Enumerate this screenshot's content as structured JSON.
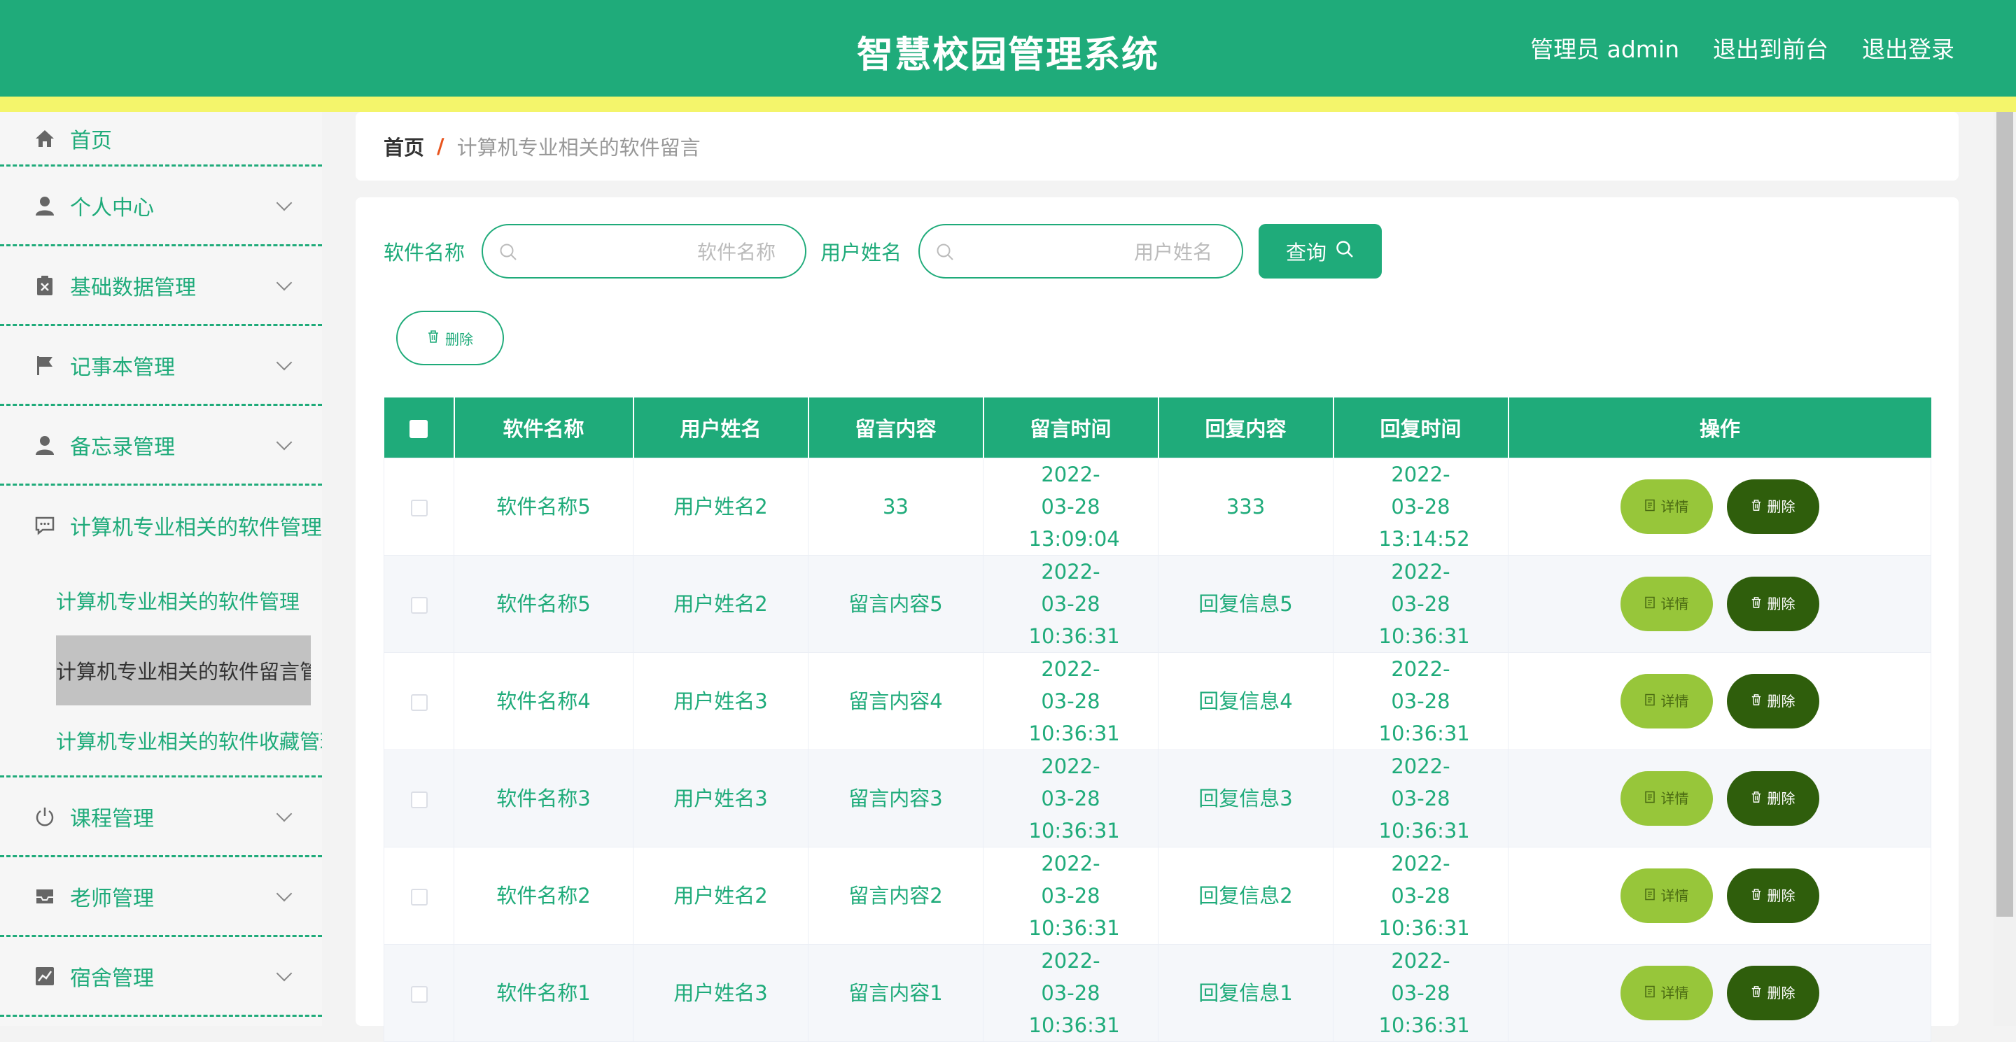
{
  "header": {
    "title": "智慧校园管理系统",
    "user_label": "管理员 admin",
    "to_front": "退出到前台",
    "logout": "退出登录"
  },
  "sidebar": {
    "home": "首页",
    "items": [
      {
        "label": "个人中心",
        "icon": "person-icon"
      },
      {
        "label": "基础数据管理",
        "icon": "clipboard-icon"
      },
      {
        "label": "记事本管理",
        "icon": "flag-icon"
      },
      {
        "label": "备忘录管理",
        "icon": "person-icon"
      }
    ],
    "software_group": {
      "label": "计算机专业相关的软件管理",
      "icon": "chat-icon",
      "subitems": [
        "计算机专业相关的软件管理",
        "计算机专业相关的软件留言管理",
        "计算机专业相关的软件收藏管理"
      ]
    },
    "items_after": [
      {
        "label": "课程管理",
        "icon": "power-icon"
      },
      {
        "label": "老师管理",
        "icon": "inbox-icon"
      },
      {
        "label": "宿舍管理",
        "icon": "chart-icon"
      }
    ]
  },
  "breadcrumb": {
    "home": "首页",
    "separator": "/",
    "current": "计算机专业相关的软件留言"
  },
  "search": {
    "software_label": "软件名称",
    "software_placeholder": "软件名称",
    "user_label": "用户姓名",
    "user_placeholder": "用户姓名",
    "query_button": "查询"
  },
  "toolbar": {
    "delete_label": "删除"
  },
  "table": {
    "columns": [
      "软件名称",
      "用户姓名",
      "留言内容",
      "留言时间",
      "回复内容",
      "回复时间",
      "操作"
    ],
    "detail_label": "详情",
    "delete_label": "删除",
    "rows": [
      {
        "software": "软件名称5",
        "user": "用户姓名2",
        "content": "33",
        "time": "2022-03-28 13:09:04",
        "reply": "333",
        "reply_time": "2022-03-28 13:14:52"
      },
      {
        "software": "软件名称5",
        "user": "用户姓名2",
        "content": "留言内容5",
        "time": "2022-03-28 10:36:31",
        "reply": "回复信息5",
        "reply_time": "2022-03-28 10:36:31"
      },
      {
        "software": "软件名称4",
        "user": "用户姓名3",
        "content": "留言内容4",
        "time": "2022-03-28 10:36:31",
        "reply": "回复信息4",
        "reply_time": "2022-03-28 10:36:31"
      },
      {
        "software": "软件名称3",
        "user": "用户姓名3",
        "content": "留言内容3",
        "time": "2022-03-28 10:36:31",
        "reply": "回复信息3",
        "reply_time": "2022-03-28 10:36:31"
      },
      {
        "software": "软件名称2",
        "user": "用户姓名2",
        "content": "留言内容2",
        "time": "2022-03-28 10:36:31",
        "reply": "回复信息2",
        "reply_time": "2022-03-28 10:36:31"
      },
      {
        "software": "软件名称1",
        "user": "用户姓名3",
        "content": "留言内容1",
        "time": "2022-03-28 10:36:31",
        "reply": "回复信息1",
        "reply_time": "2022-03-28 10:36:31"
      }
    ]
  },
  "colors": {
    "primary": "#1fab7a",
    "accent_line": "#f4f56b",
    "detail_button": "#97c63a",
    "delete_button": "#2f5e0c"
  }
}
